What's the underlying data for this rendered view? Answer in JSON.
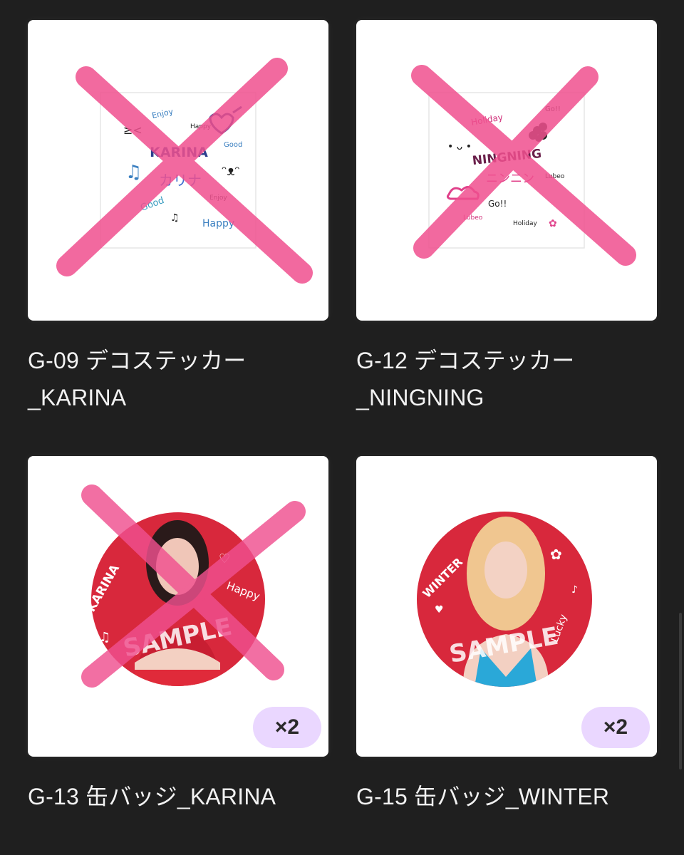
{
  "items": [
    {
      "title_line1": "G-09 デコステッカー",
      "title_line2": "_KARINA",
      "sticker_name": "KARINA",
      "sticker_kana": "カリナ",
      "sticker_words": [
        "Enjoy",
        "Happy",
        "Good",
        "Good",
        "Enjoy",
        "Happy"
      ],
      "crossed_out": true
    },
    {
      "title_line1": "G-12 デコステッカー",
      "title_line2": "_NINGNING",
      "sticker_name": "NINGNING",
      "sticker_kana": "ニンニン",
      "sticker_words": [
        "Holiday",
        "Go!!",
        "Lubeo",
        "Go!!",
        "Lubeo",
        "Holiday"
      ],
      "crossed_out": true
    },
    {
      "title_line1": "G-13 缶バッジ_KARINA",
      "badge_name": "KARINA",
      "badge_word": "Happy",
      "sample_label": "SAMPLE",
      "quantity": "×2",
      "crossed_out": true
    },
    {
      "title_line1": "G-15 缶バッジ_WINTER",
      "badge_name": "WINTER",
      "badge_word": "Lucky",
      "sample_label": "SAMPLE",
      "quantity": "×2",
      "crossed_out": false
    }
  ],
  "colors": {
    "background": "#1f1f1f",
    "cross_mark": "#f0508f",
    "badge_red": "#d8283c",
    "quantity_pill": "#ead7ff"
  },
  "icons": [
    "x-cross-mark-icon",
    "heart-icon",
    "music-note-icon",
    "flower-icon",
    "cloud-icon",
    "bow-icon"
  ]
}
